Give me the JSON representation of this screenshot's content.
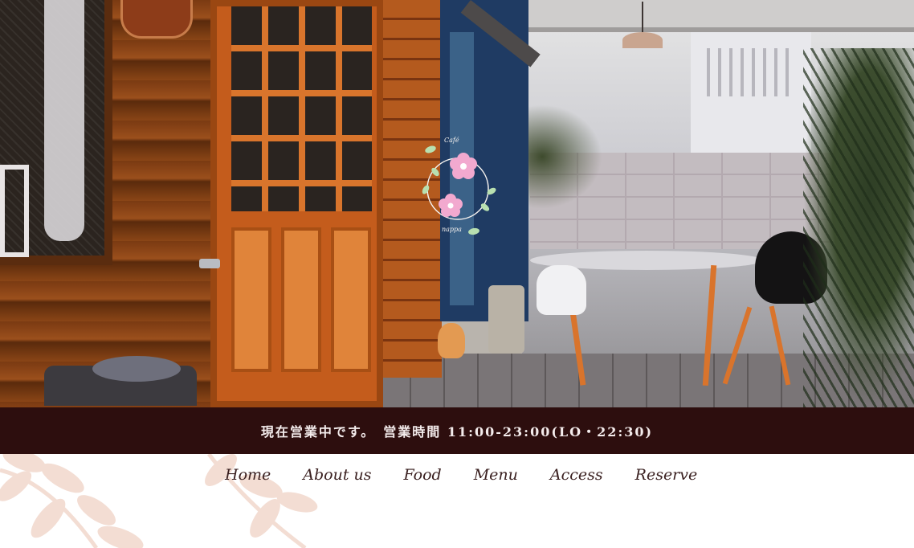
{
  "status_bar": {
    "text": "現在営業中です。　営業時間 11:00-23:00(LO・22:30)",
    "background": "#2d0e0e",
    "text_color": "#f4ecec"
  },
  "logo": {
    "arc_text_top": "Café",
    "arc_text_bottom": "nappa"
  },
  "nav": {
    "items": [
      {
        "label": "Home"
      },
      {
        "label": "About us"
      },
      {
        "label": "Food"
      },
      {
        "label": "Menu"
      },
      {
        "label": "Access"
      },
      {
        "label": "Reserve"
      }
    ]
  },
  "colors": {
    "accent": "#2d0e0e",
    "leaf": "#f0d9cf",
    "flower": "#f2a9cf",
    "logo_leaf": "#b8e0b0"
  },
  "icons": {
    "logo": "flower-wreath-logo-icon",
    "decoration": "leaf-branch-icon"
  }
}
